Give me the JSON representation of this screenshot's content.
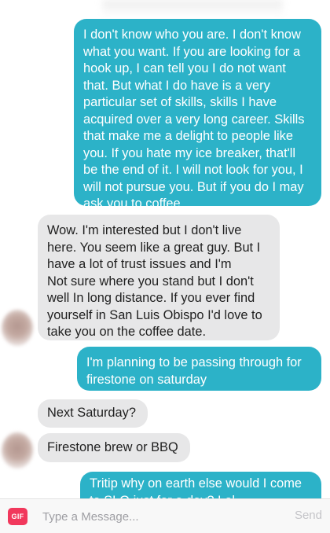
{
  "messages": [
    {
      "direction": "sent",
      "text": "I don't know who you are. I don't know what you want. If you are looking for a hook up, I can tell you I do not want that. But what I do have is a very particular set of skills, skills I have acquired over a very long career. Skills that make me a delight to people like you. If you hate my ice breaker, that'll be the end of it. I will not look for you, I will not pursue you. But if you do I may ask you to coffee"
    },
    {
      "direction": "received",
      "text": "Wow. I'm interested but I don't live here.  You seem like a great guy. But I have a lot of trust issues and I'm\nNot sure where you stand but I don't well In long distance. If you ever find yourself in San Luis Obispo I'd love to take you on the coffee date."
    },
    {
      "direction": "sent",
      "text": "I'm planning to be passing through for firestone on saturday"
    },
    {
      "direction": "received",
      "text": "Next Saturday?"
    },
    {
      "direction": "received",
      "text": "Firestone brew or BBQ"
    },
    {
      "direction": "sent",
      "text": "Tritip why on earth else would I come to SLO just for a day? Lol"
    }
  ],
  "composer": {
    "gif_label": "GIF",
    "placeholder": "Type a Message...",
    "send_label": "Send"
  },
  "colors": {
    "sent_bubble": "#2cb2c8",
    "received_bubble": "#e7e7e8",
    "gif_button": "#f1385c",
    "send_disabled": "#c4c4c8"
  }
}
